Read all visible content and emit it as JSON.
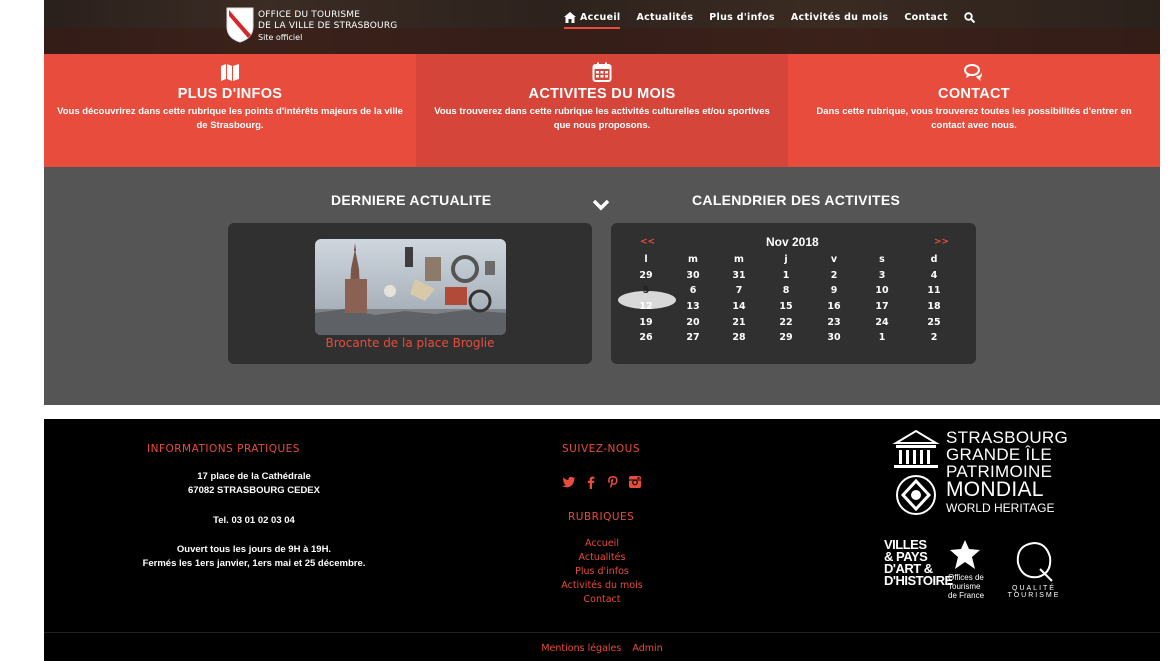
{
  "header": {
    "logo_line1": "OFFICE DU TOURISME",
    "logo_line2": "DE LA VILLE DE STRASBOURG",
    "logo_line3": "Site officiel",
    "nav": [
      {
        "label": "Accueil",
        "active": true
      },
      {
        "label": "Actualités",
        "active": false
      },
      {
        "label": "Plus d'infos",
        "active": false
      },
      {
        "label": "Activités du mois",
        "active": false
      },
      {
        "label": "Contact",
        "active": false
      }
    ]
  },
  "features": [
    {
      "icon": "map-icon",
      "title": "PLUS D'INFOS",
      "text": "Vous découvrirez dans cette rubrique les points d'intérêts majeurs de la ville de Strasbourg."
    },
    {
      "icon": "calendar-icon",
      "title": "ACTIVITES DU MOIS",
      "text": "Vous trouverez dans cette rubrique les activités culturelles et/ou sportives que nous proposons."
    },
    {
      "icon": "chat-icon",
      "title": "CONTACT",
      "text": "Dans cette rubrique, vous trouverez toutes les possibilités d'entrer en contact avec nous."
    }
  ],
  "news": {
    "section_title": "DERNIERE ACTUALITE",
    "item_title": "Brocante de la place Broglie"
  },
  "calendar": {
    "section_title": "CALENDRIER DES ACTIVITES",
    "month": "Nov 2018",
    "prev": "<<",
    "next": ">>",
    "weekdays": [
      "l",
      "m",
      "m",
      "j",
      "v",
      "s",
      "d"
    ],
    "weeks": [
      [
        "29",
        "30",
        "31",
        "1",
        "2",
        "3",
        "4"
      ],
      [
        "5",
        "6",
        "7",
        "8",
        "9",
        "10",
        "11"
      ],
      [
        "12",
        "13",
        "14",
        "15",
        "16",
        "17",
        "18"
      ],
      [
        "19",
        "20",
        "21",
        "22",
        "23",
        "24",
        "25"
      ],
      [
        "26",
        "27",
        "28",
        "29",
        "30",
        "1",
        "2"
      ]
    ],
    "today": "5"
  },
  "footer": {
    "info_title": "INFORMATIONS PRATIQUES",
    "address1": "17 place de la Cathédrale",
    "address2": "67082 STRASBOURG CEDEX",
    "phone": "Tel. 03 01 02 03 04",
    "hours1": "Ouvert tous les jours de 9H à 19H.",
    "hours2": "Fermés les 1ers janvier, 1ers mai et 25 décembre.",
    "follow_title": "SUIVEZ-NOUS",
    "rubriques_title": "RUBRIQUES",
    "rubriques": [
      "Accueil",
      "Actualités",
      "Plus d'infos",
      "Activités du mois",
      "Contact"
    ],
    "unesco_line1": "STRASBOURG",
    "unesco_line2": "GRANDE ÎLE",
    "unesco_line3": "PATRIMOINE",
    "unesco_line4": "MONDIAL",
    "unesco_line5": "WORLD HERITAGE",
    "vpah": "VILLES & PAYS D'ART & D'HISTOIRE",
    "otf": "Offices de Tourisme de France",
    "qualite": "QUALITÉ TOURISME",
    "mentions": "Mentions légales",
    "admin": "Admin"
  },
  "colors": {
    "accent": "#e84c3d",
    "mid_bg": "#555555",
    "panel": "#303030"
  }
}
